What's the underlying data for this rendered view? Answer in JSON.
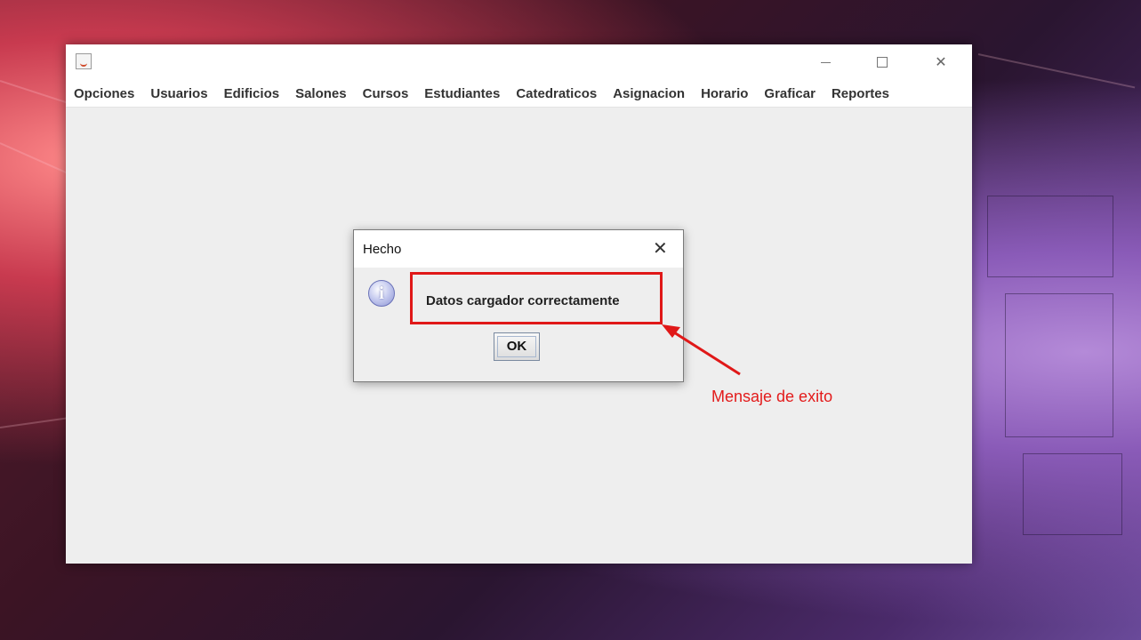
{
  "window": {
    "icon": "java-icon",
    "controls": {
      "minimize": "minimize-icon",
      "maximize": "maximize-icon",
      "close": "close-icon"
    }
  },
  "menu": {
    "items": [
      "Opciones",
      "Usuarios",
      "Edificios",
      "Salones",
      "Cursos",
      "Estudiantes",
      "Catedraticos",
      "Asignacion",
      "Horario",
      "Graficar",
      "Reportes"
    ]
  },
  "dialog": {
    "title": "Hecho",
    "close_glyph": "✕",
    "icon": "info-icon",
    "icon_glyph": "i",
    "message": "Datos cargador correctamente",
    "ok_label": "OK"
  },
  "annotation": {
    "label": "Mensaje de exito",
    "color": "#e31b1b"
  },
  "colors": {
    "window_bg": "#eeeeee",
    "annotation": "#e01818"
  }
}
